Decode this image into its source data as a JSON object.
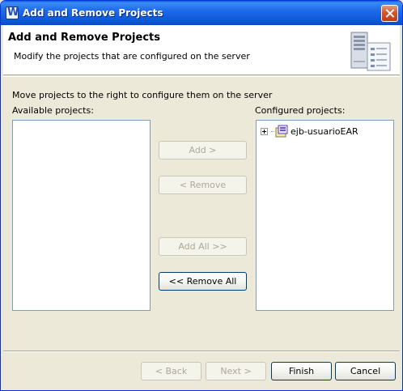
{
  "window": {
    "title": "Add and Remove Projects",
    "icon": "app-w-icon"
  },
  "banner": {
    "title": "Add and Remove Projects",
    "description": "Modify the projects that are configured on the server",
    "art": "server-config-icon"
  },
  "instructions": "Move projects to the right to configure them on the server",
  "available": {
    "label": "Available projects:",
    "items": []
  },
  "configured": {
    "label": "Configured projects:",
    "items": [
      {
        "label": "ejb-usuarioEAR",
        "icon": "ear-project-icon",
        "expandable": true
      }
    ]
  },
  "transfer_buttons": {
    "add": {
      "label": "Add >",
      "enabled": false
    },
    "remove": {
      "label": "< Remove",
      "enabled": false
    },
    "add_all": {
      "label": "Add All >>",
      "enabled": false
    },
    "remove_all": {
      "label": "<< Remove All",
      "enabled": true
    }
  },
  "footer_buttons": {
    "back": {
      "label": "< Back",
      "enabled": false
    },
    "next": {
      "label": "Next >",
      "enabled": false
    },
    "finish": {
      "label": "Finish",
      "enabled": true
    },
    "cancel": {
      "label": "Cancel",
      "enabled": true
    }
  },
  "colors": {
    "titlebar": "#0B55D8",
    "dialog_bg": "#ECE9D8",
    "list_border": "#7F9DB9",
    "close": "#D8542B"
  }
}
